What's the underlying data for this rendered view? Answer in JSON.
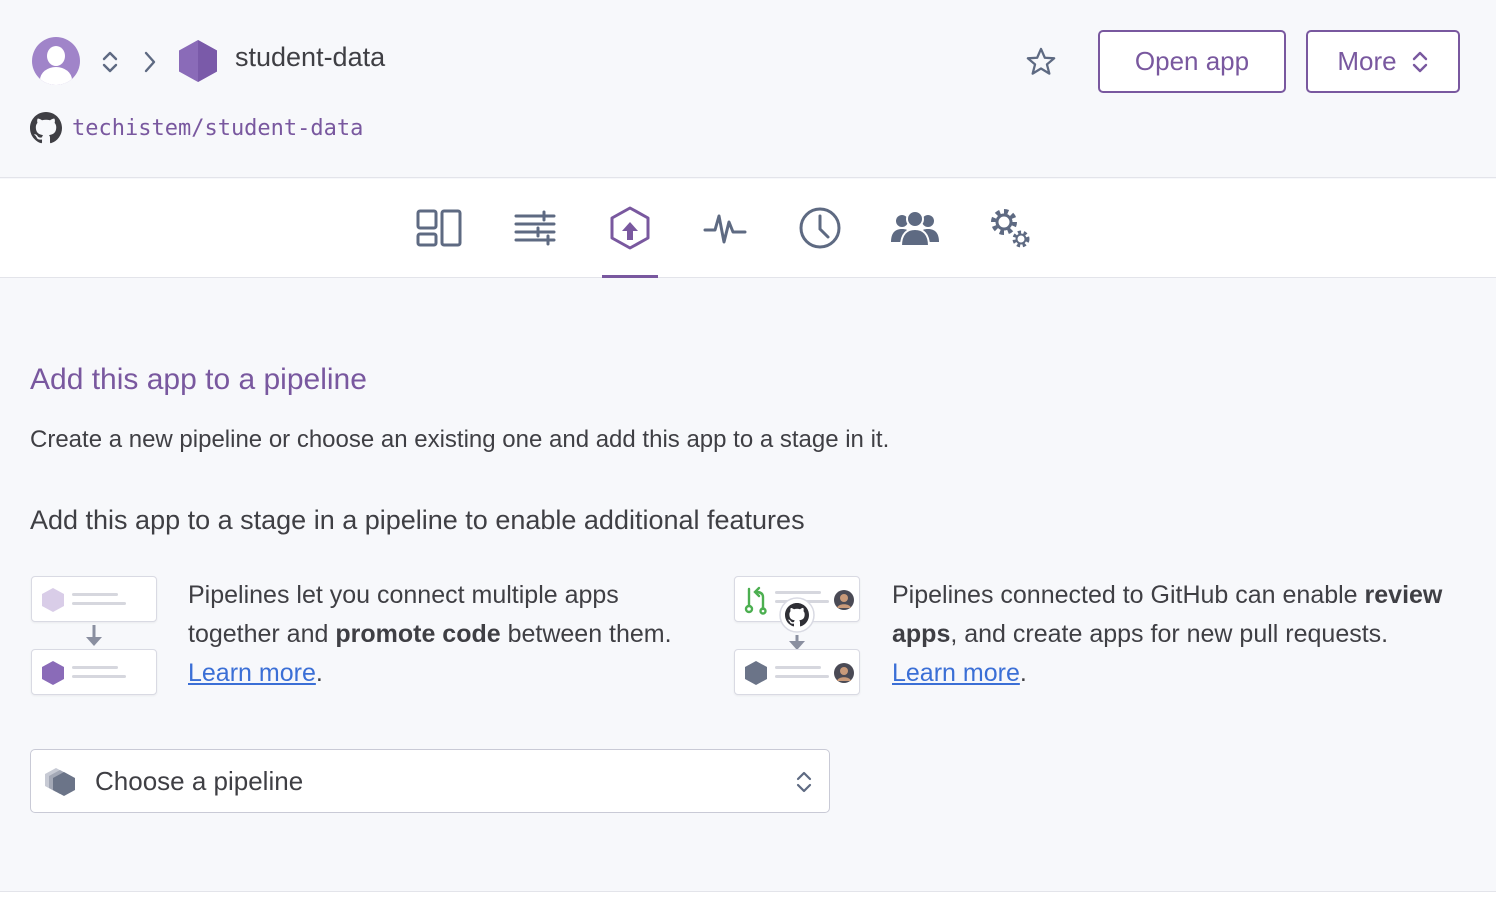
{
  "header": {
    "app_name": "student-data",
    "repo": "techistem/student-data",
    "open_app_label": "Open app",
    "more_label": "More",
    "avatar_icon": "user-avatar-icon",
    "app_icon": "hexagon-app-icon",
    "repo_icon": "github-icon"
  },
  "tabs": [
    {
      "name": "overview",
      "icon": "overview-icon"
    },
    {
      "name": "resources",
      "icon": "resources-sliders-icon"
    },
    {
      "name": "deploy",
      "icon": "deploy-upload-icon",
      "active": true
    },
    {
      "name": "metrics",
      "icon": "metrics-pulse-icon"
    },
    {
      "name": "activity",
      "icon": "activity-clock-icon"
    },
    {
      "name": "access",
      "icon": "access-people-icon"
    },
    {
      "name": "settings",
      "icon": "settings-gears-icon"
    }
  ],
  "main": {
    "title": "Add this app to a pipeline",
    "description": "Create a new pipeline or choose an existing one and add this app to a stage in it.",
    "subheading": "Add this app to a stage in a pipeline to enable additional features",
    "feature1": {
      "text_before": "Pipelines let you connect multiple apps together and ",
      "bold": "promote code",
      "text_after": " between them. ",
      "link": "Learn more",
      "end": "."
    },
    "feature2": {
      "text_before": "Pipelines connected to GitHub can enable ",
      "bold": "review apps",
      "text_after": ", and create apps for new pull requests. ",
      "link": "Learn more",
      "end": "."
    },
    "select": {
      "label": "Choose a pipeline",
      "icon": "pipeline-stack-icon"
    }
  },
  "colors": {
    "accent": "#79589f",
    "link": "#3b6fd6",
    "text": "#3f3f44",
    "icon_gray": "#5e6a82"
  }
}
